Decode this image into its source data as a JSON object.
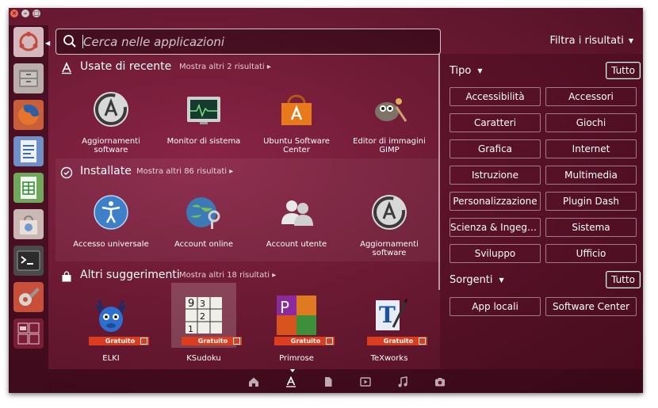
{
  "window": {
    "close_label": "×",
    "minimize_label": "–",
    "maximize_label": "□"
  },
  "search": {
    "placeholder": "Cerca nelle applicazioni"
  },
  "filter_header": {
    "label": "Filtra i risultati",
    "arrow": "▼"
  },
  "launcher": {
    "items": [
      "ubuntu-dash-icon",
      "files-icon",
      "firefox-icon",
      "writer-icon",
      "calc-icon",
      "software-center-icon",
      "terminal-icon",
      "settings-icon",
      "workspace-switcher-icon"
    ]
  },
  "categories": [
    {
      "title": "Usate di recente",
      "more": "Mostra altri 2 risultati",
      "icon": "applications-lens-icon",
      "apps": [
        {
          "label": "Aggiornamenti software",
          "icon": "software-updater-icon"
        },
        {
          "label": "Monitor di sistema",
          "icon": "system-monitor-icon"
        },
        {
          "label": "Ubuntu Software Center",
          "icon": "software-center-icon"
        },
        {
          "label": "Editor di immagini GIMP",
          "icon": "gimp-icon"
        }
      ]
    },
    {
      "title": "Installate",
      "more": "Mostra altri 86 risultati",
      "icon": "check-circle-icon",
      "apps": [
        {
          "label": "Accesso universale",
          "icon": "universal-access-icon"
        },
        {
          "label": "Account online",
          "icon": "online-accounts-icon"
        },
        {
          "label": "Account utente",
          "icon": "user-accounts-icon"
        },
        {
          "label": "Aggiornamenti software",
          "icon": "software-updater-icon"
        }
      ]
    },
    {
      "title": "Altri suggerimenti",
      "more": "Mostra altri 18 risultati",
      "icon": "shopping-bag-icon",
      "apps": [
        {
          "label": "ELKI",
          "icon": "elki-icon",
          "badge": "Gratuito"
        },
        {
          "label": "KSudoku",
          "icon": "ksudoku-icon",
          "badge": "Gratuito"
        },
        {
          "label": "Primrose",
          "icon": "primrose-icon",
          "badge": "Gratuito"
        },
        {
          "label": "TeXworks",
          "icon": "texworks-icon",
          "badge": "Gratuito"
        }
      ]
    }
  ],
  "filters": {
    "tipo": {
      "title": "Tipo",
      "all_label": "Tutto",
      "options": [
        "Accessibilità",
        "Accessori",
        "Caratteri",
        "Giochi",
        "Grafica",
        "Internet",
        "Istruzione",
        "Multimedia",
        "Personalizzazione",
        "Plugin Dash",
        "Scienza & Ingegneria",
        "Sistema",
        "Sviluppo",
        "Ufficio"
      ]
    },
    "sorgenti": {
      "title": "Sorgenti",
      "all_label": "Tutto",
      "options": [
        "App locali",
        "Software Center"
      ]
    }
  },
  "lenses": [
    "home-lens-icon",
    "applications-lens-icon",
    "files-lens-icon",
    "video-lens-icon",
    "music-lens-icon",
    "photo-lens-icon"
  ],
  "colors": {
    "accent": "#dc3d1e",
    "background": "#6b1a33"
  }
}
